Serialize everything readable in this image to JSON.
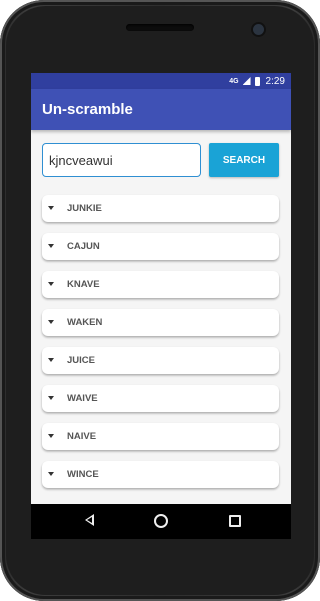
{
  "status_bar": {
    "network": "4G",
    "time": "2:29"
  },
  "app_bar": {
    "title": "Un-scramble"
  },
  "search": {
    "value": "kjncveawui",
    "button_label": "SEARCH"
  },
  "results": [
    {
      "word": "JUNKIE"
    },
    {
      "word": "CAJUN"
    },
    {
      "word": "KNAVE"
    },
    {
      "word": "WAKEN"
    },
    {
      "word": "JUICE"
    },
    {
      "word": "WAIVE"
    },
    {
      "word": "NAIVE"
    },
    {
      "word": "WINCE"
    }
  ],
  "colors": {
    "primary": "#3f51b5",
    "primary_dark": "#303f9f",
    "accent": "#1aa3d6"
  },
  "icons": {
    "result_toggle": "caret-down-icon",
    "nav": [
      "back-icon",
      "home-icon",
      "recents-icon"
    ]
  }
}
